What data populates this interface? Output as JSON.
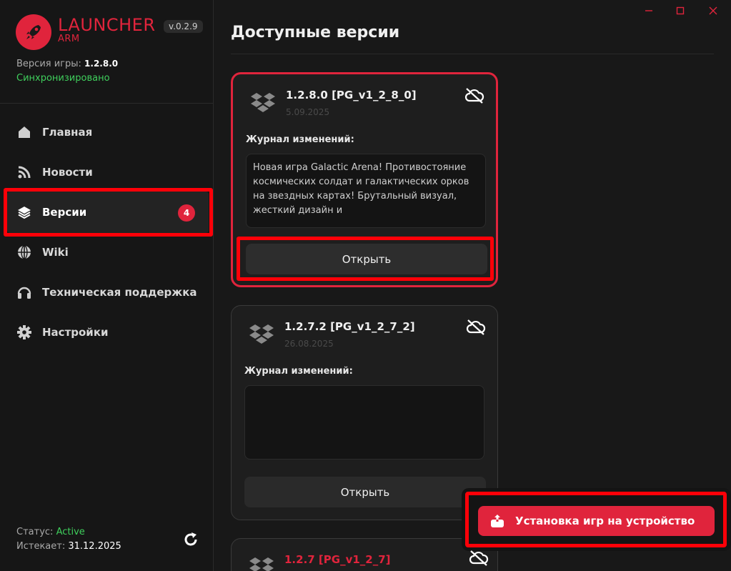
{
  "app": {
    "logo_main": "LAUNCHER",
    "logo_sub": "ARM",
    "version": "v.0.2.9",
    "game_version_label": "Версия игры:",
    "game_version": "1.2.8.0",
    "sync_status": "Синхронизировано"
  },
  "nav": {
    "items": [
      {
        "label": "Главная",
        "icon": "home-icon"
      },
      {
        "label": "Новости",
        "icon": "rss-icon"
      },
      {
        "label": "Версии",
        "icon": "layers-icon",
        "badge": "4",
        "active": true
      },
      {
        "label": "Wiki",
        "icon": "globe-icon"
      },
      {
        "label": "Техническая поддержка",
        "icon": "headphones-icon"
      },
      {
        "label": "Настройки",
        "icon": "gear-icon"
      }
    ]
  },
  "footer": {
    "status_label": "Статус:",
    "status_value": "Active",
    "expires_label": "Истекает:",
    "expires_value": "31.12.2025"
  },
  "main": {
    "title": "Доступные версии",
    "changelog_label": "Журнал изменений:",
    "open_label": "Открыть",
    "install_label": "Установка игр на устройство",
    "versions": [
      {
        "title": "1.2.8.0 [PG_v1_2_8_0]",
        "date": "5.09.2025",
        "changelog": "Новая игра Galactic Arena! Противостояние космических солдат и галактических орков на звездных картах! Брутальный визуал, жесткий дизайн и"
      },
      {
        "title": "1.2.7.2 [PG_v1_2_7_2]",
        "date": "26.08.2025",
        "changelog": ""
      },
      {
        "title": "1.2.7 [PG_v1_2_7]",
        "date": ""
      }
    ]
  },
  "colors": {
    "accent": "#e0243c",
    "highlight": "#ff0008",
    "success": "#3fcf5c"
  }
}
